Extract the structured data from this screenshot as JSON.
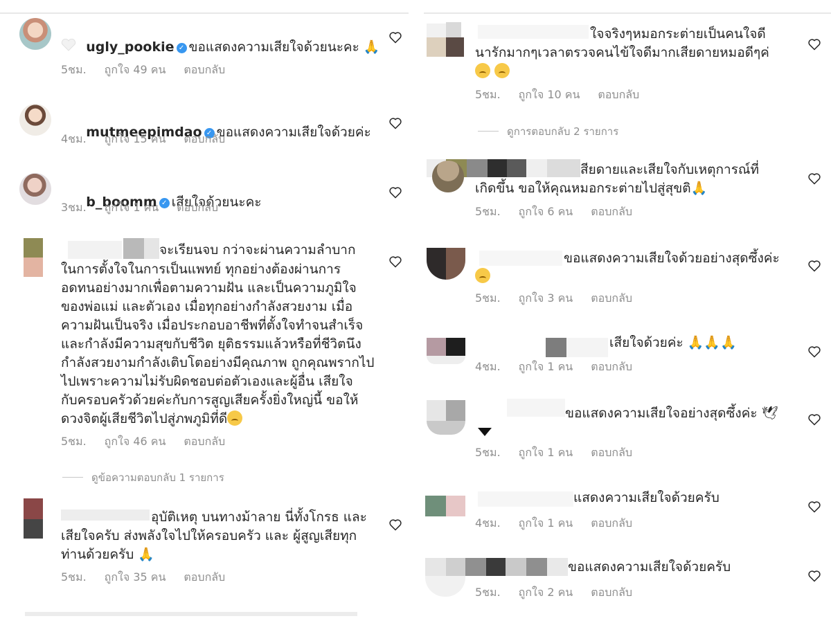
{
  "colors": {
    "text": "#262626",
    "muted": "#8e8e8e",
    "verified": "#3897f0",
    "heart_stroke": "#262626"
  },
  "left": [
    {
      "username": "ugly_pookie",
      "verified": true,
      "text": "ขอแสดงความเสียใจด้วยนะคะ 🙏",
      "time": "5ชม.",
      "likes": "ถูกใจ 49 คน",
      "reply": "ตอบกลับ"
    },
    {
      "username": "mutmeepimdao",
      "verified": true,
      "text": "ขอแสดงความเสียใจด้วยค่ะ",
      "time": "4ชม.",
      "likes": "ถูกใจ 15 คน",
      "reply": "ตอบกลับ"
    },
    {
      "username": "b_boomm",
      "verified": true,
      "text": "เสียใจด้วยนะคะ",
      "time": "3ชม.",
      "likes": "ถูกใจ 1 คน",
      "reply": "ตอบกลับ"
    },
    {
      "lines": [
        "จะเรียนจบ กว่าจะผ่านความลำบาก",
        "ในการตั้งใจในการเป็นแพทย์ ทุกอย่างต้องผ่านการ",
        "อดทนอย่างมากเพื่อตามความฝัน และเป็นความภูมิใจ",
        "ของพ่อแม่ และตัวเอง เมื่อทุกอย่างกำลังสวยงาม เมื่อ",
        "ความฝันเป็นจริง เมื่อประกอบอาชีพที่ตั้งใจทำจนสำเร็จ",
        "และกำลังมีความสุขกับชีวิต ยุติธรรมแล้วหรือที่ชีวิตนึง",
        "กำลังสวยงามกำลังเติบโตอย่างมีคุณภาพ ถูกคุณพรากไป",
        "ไปเพราะความไม่รับผิดชอบต่อตัวเองและผู้อื่น เสียใจ",
        "กับครอบครัวด้วยค่ะกับการสูญเสียครั้งยิ่งใหญ่นี้ ขอให้",
        "ดวงจิตผู้เสียชีวิตไปสู่ภพภูมิที่ดี"
      ],
      "time": "5ชม.",
      "likes": "ถูกใจ 46 คน",
      "reply": "ตอบกลับ",
      "view_replies": "ดูข้อความตอบกลับ 1 รายการ"
    },
    {
      "lines": [
        "อุบัติเหตุ บนทางม้าลาย นี่ทั้งโกรธ และ",
        "เสียใจครับ ส่งพลังใจไปให้ครอบครัว และ ผู้สูญเสียทุก",
        "ท่านด้วยครับ 🙏"
      ],
      "time": "5ชม.",
      "likes": "ถูกใจ 35 คน",
      "reply": "ตอบกลับ"
    }
  ],
  "right": [
    {
      "lines": [
        "ใจจริงๆหมอกระต่ายเป็นคนใจดี",
        "นารักมากๆเวลาตรวจคนไข้ใจดีมากเสียดายหมอดีๆค่"
      ],
      "time": "5ชม.",
      "likes": "ถูกใจ 10 คน",
      "reply": "ตอบกลับ",
      "view_replies": "ดูการตอบกลับ 2 รายการ"
    },
    {
      "lines": [
        "สียดายและเสียใจกับเหตุการณ์ที่",
        "เกิดขึ้น ขอให้คุณหมอกระต่ายไปสู่สุขติ🙏"
      ],
      "time": "5ชม.",
      "likes": "ถูกใจ 6 คน",
      "reply": "ตอบกลับ"
    },
    {
      "lines": [
        "ขอแสดงความเสียใจด้วยอย่างสุดซึ้งค่ะ"
      ],
      "time": "5ชม.",
      "likes": "ถูกใจ 3 คน",
      "reply": "ตอบกลับ"
    },
    {
      "lines": [
        "เสียใจด้วยค่ะ 🙏🙏🙏"
      ],
      "time": "4ชม.",
      "likes": "ถูกใจ 1 คน",
      "reply": "ตอบกลับ"
    },
    {
      "lines": [
        "ขอแสดงความเสียใจอย่างสุดซึ้งค่ะ 🕊"
      ],
      "time": "5ชม.",
      "likes": "ถูกใจ 1 คน",
      "reply": "ตอบกลับ"
    },
    {
      "lines": [
        "แสดงความเสียใจด้วยครับ"
      ],
      "time": "4ชม.",
      "likes": "ถูกใจ 1 คน",
      "reply": "ตอบกลับ"
    },
    {
      "lines": [
        "ขอแสดงความเสียใจด้วยครับ"
      ],
      "time": "5ชม.",
      "likes": "ถูกใจ 2 คน",
      "reply": "ตอบกลับ"
    }
  ]
}
